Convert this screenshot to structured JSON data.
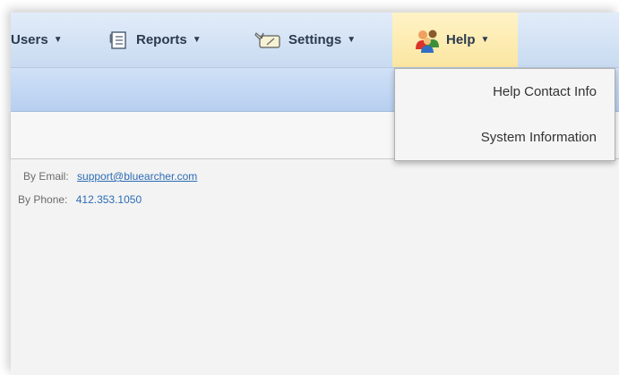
{
  "nav": {
    "users": {
      "label": "Users",
      "icon": "users-icon"
    },
    "reports": {
      "label": "Reports",
      "icon": "reports-icon"
    },
    "settings": {
      "label": "Settings",
      "icon": "settings-icon"
    },
    "help": {
      "label": "Help",
      "icon": "help-people-icon"
    }
  },
  "help_menu": {
    "items": [
      {
        "label": "Help Contact Info"
      },
      {
        "label": "System Information"
      }
    ]
  },
  "contact": {
    "email_label": "By Email:",
    "email_value": "support@bluearcher.com",
    "phone_label": "By Phone:",
    "phone_value": "412.353.1050"
  },
  "colors": {
    "accent_blue": "#c8dbf1",
    "help_highlight": "#fbe6a1",
    "link": "#2d6cb5"
  }
}
